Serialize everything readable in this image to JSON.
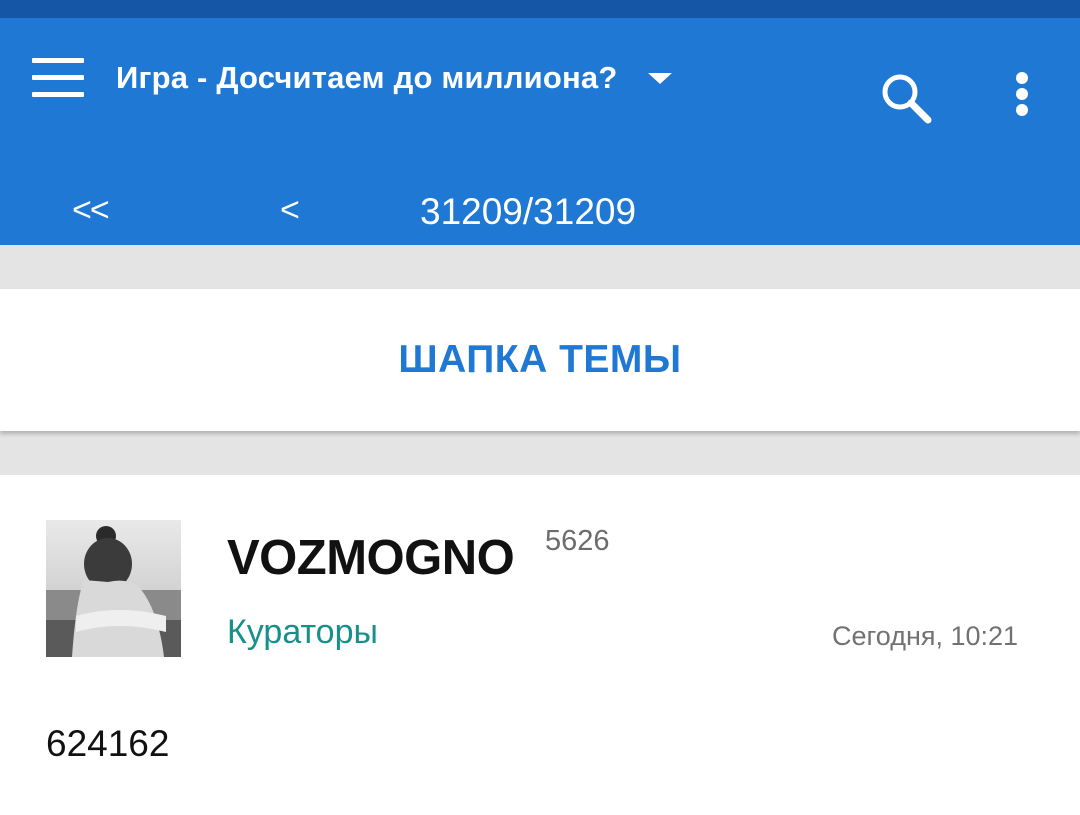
{
  "appbar": {
    "title": "Игра - Досчитаем до миллиона?",
    "first_page_label": "<<",
    "prev_page_label": "<",
    "page_counter": "31209/31209",
    "background_color": "#1f78d3"
  },
  "topic_header": {
    "label": "ШАПКА ТЕМЫ"
  },
  "post": {
    "username": "VOZMOGNO",
    "reputation": "5626",
    "group": "Кураторы",
    "time": "Сегодня, 10:21",
    "body": "624162"
  },
  "icons": {
    "menu": "hamburger-menu-icon",
    "dropdown": "caret-down-icon",
    "search": "search-icon",
    "more": "more-vert-icon"
  }
}
